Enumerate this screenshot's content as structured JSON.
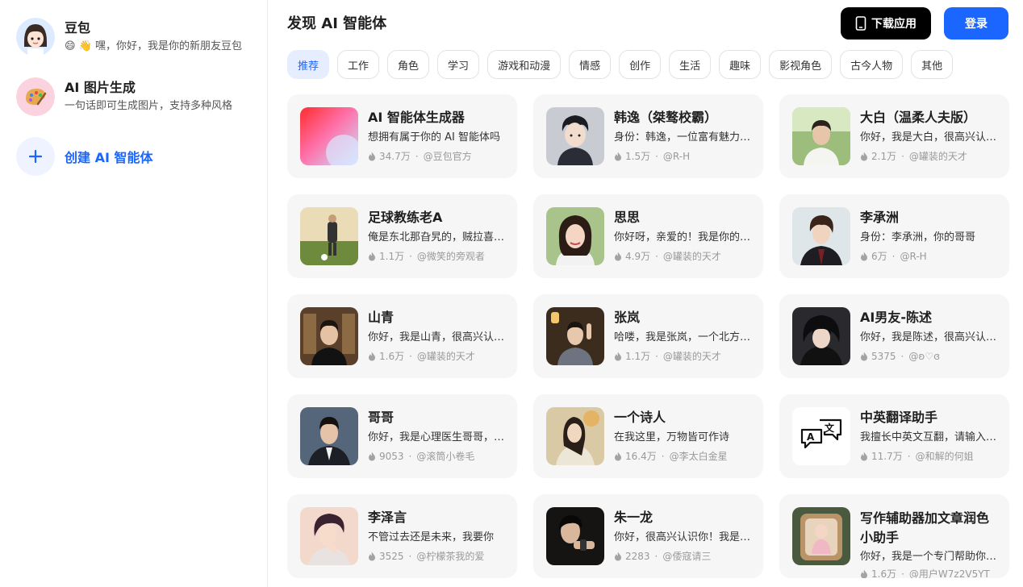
{
  "sidebar": {
    "items": [
      {
        "title": "豆包",
        "subtitle": "😄 👋 嘿，你好，我是你的新朋友豆包"
      },
      {
        "title": "AI 图片生成",
        "subtitle": "一句话即可生成图片，支持多种风格"
      }
    ],
    "create_label": "创建 AI 智能体"
  },
  "header": {
    "title": "发现 AI 智能体",
    "download_label": "下载应用",
    "login_label": "登录"
  },
  "tabs": [
    "推荐",
    "工作",
    "角色",
    "学习",
    "游戏和动漫",
    "情感",
    "创作",
    "生活",
    "趣味",
    "影视角色",
    "古今人物",
    "其他"
  ],
  "cards": [
    {
      "title": "AI 智能体生成器",
      "desc": "想拥有属于你的 AI 智能体吗",
      "count": "34.7万",
      "author": "@豆包官方"
    },
    {
      "title": "韩逸（桀骜校霸）",
      "desc": "身份：韩逸，一位富有魅力的校霸",
      "count": "1.5万",
      "author": "@R-H"
    },
    {
      "title": "大白（温柔人夫版）",
      "desc": "你好，我是大白，很高兴认识你",
      "count": "2.1万",
      "author": "@罐装的天才"
    },
    {
      "title": "足球教练老A",
      "desc": "俺是东北那旮旯的，贼拉喜欢足球",
      "count": "1.1万",
      "author": "@微笑的旁观者"
    },
    {
      "title": "思思",
      "desc": "你好呀，亲爱的！我是你的思思",
      "count": "4.9万",
      "author": "@罐装的天才"
    },
    {
      "title": "李承洲",
      "desc": "身份：李承洲，你的哥哥",
      "count": "6万",
      "author": "@R-H"
    },
    {
      "title": "山青",
      "desc": "你好，我是山青，很高兴认识你",
      "count": "1.6万",
      "author": "@罐装的天才"
    },
    {
      "title": "张岚",
      "desc": "哈喽，我是张岚，一个北方姑娘",
      "count": "1.1万",
      "author": "@罐装的天才"
    },
    {
      "title": "AI男友-陈述",
      "desc": "你好，我是陈述，很高兴认识你",
      "count": "5375",
      "author": "@ʚ♡ɞ"
    },
    {
      "title": "哥哥",
      "desc": "你好，我是心理医生哥哥，有什么",
      "count": "9053",
      "author": "@滚筒小卷毛"
    },
    {
      "title": "一个诗人",
      "desc": "在我这里，万物皆可作诗",
      "count": "16.4万",
      "author": "@李太白金星"
    },
    {
      "title": "中英翻译助手",
      "desc": "我擅长中英文互翻，请输入内容",
      "count": "11.7万",
      "author": "@和解的何姐"
    },
    {
      "title": "李泽言",
      "desc": "不管过去还是未来，我要你",
      "count": "3525",
      "author": "@柠檬茶我的爱"
    },
    {
      "title": "朱一龙",
      "desc": "你好，很高兴认识你！我是朱一龙",
      "count": "2283",
      "author": "@倭寇请三"
    },
    {
      "title": "写作辅助器加文章润色小助手",
      "desc": "你好，我是一个专门帮助你写作的",
      "count": "1.6万",
      "author": "@用户W7z2V5YT"
    }
  ],
  "colors": {
    "accent": "#1a66ff",
    "card_bg": "#f6f6f7",
    "tab_active_bg": "#e5edff"
  }
}
